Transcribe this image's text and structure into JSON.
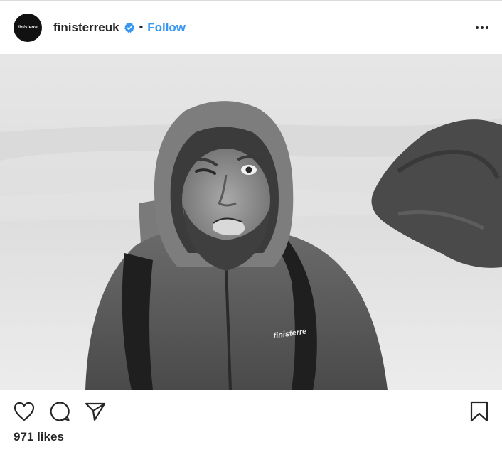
{
  "post": {
    "avatar_text": "finisterre",
    "username": "finisterreuk",
    "separator": "•",
    "follow_label": "Follow",
    "likes_text": "971 likes"
  },
  "colors": {
    "link": "#3897f0",
    "verified": "#3897f0"
  },
  "icons": {
    "verified": "verified-badge",
    "more": "ellipsis",
    "like": "heart-outline",
    "comment": "speech-bubble",
    "share": "paper-plane",
    "save": "bookmark"
  }
}
